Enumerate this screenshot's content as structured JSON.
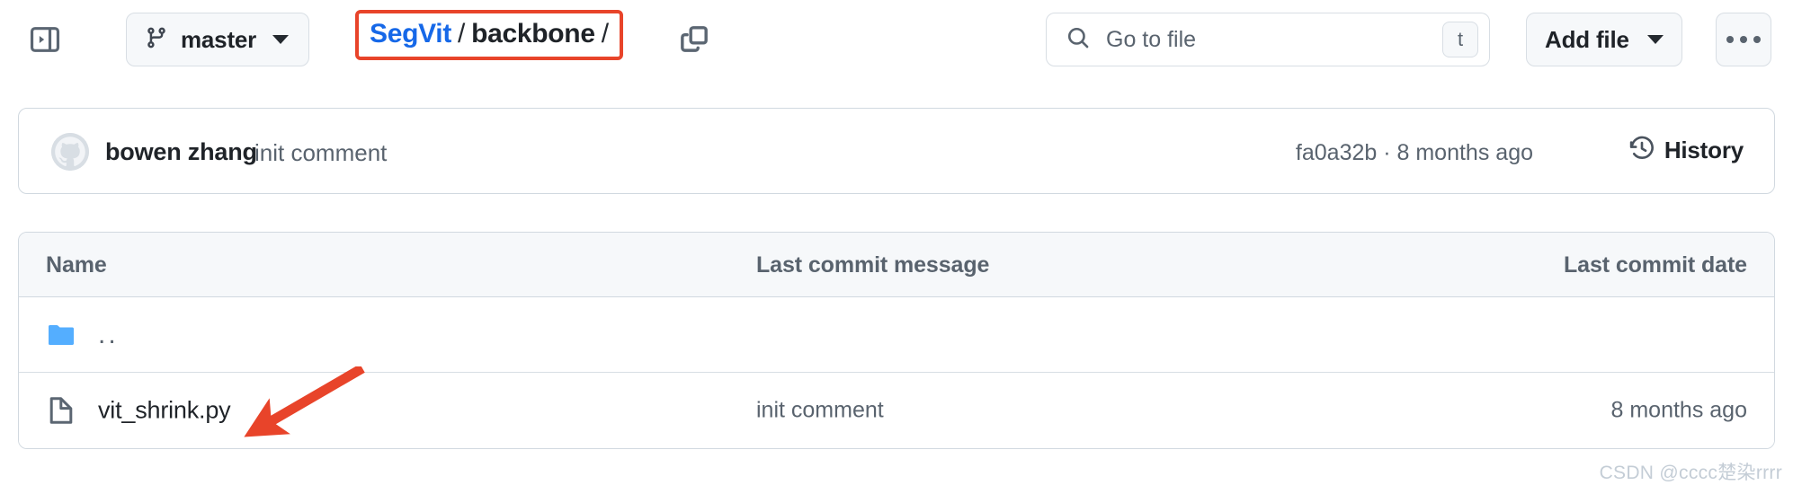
{
  "toolbar": {
    "sidebar_toggle_icon": "sidebar-expand-icon",
    "branch": {
      "icon": "git-branch-icon",
      "name": "master",
      "caret_icon": "chevron-down-icon"
    },
    "breadcrumb": {
      "repo": "SegVit",
      "separator": "/",
      "directory": "backbone",
      "trailing": "/"
    },
    "copy_path_icon": "copy-icon",
    "search": {
      "icon": "search-icon",
      "placeholder": "Go to file",
      "shortcut_key": "t"
    },
    "add_file": {
      "label": "Add file",
      "caret_icon": "chevron-down-icon"
    },
    "more_menu_icon": "kebab-horizontal-icon"
  },
  "commit_bar": {
    "avatar_icon": "octocat-avatar-icon",
    "author": "bowen zhang",
    "message": "init comment",
    "meta": "fa0a32b · 8 months ago",
    "history": {
      "icon": "history-clock-icon",
      "label": "History"
    }
  },
  "file_table": {
    "headers": {
      "name": "Name",
      "message": "Last commit message",
      "date": "Last commit date"
    },
    "rows": [
      {
        "icon": "folder-icon",
        "name": "..",
        "message": "",
        "date": "",
        "type": "parent-directory"
      },
      {
        "icon": "file-icon",
        "name": "vit_shrink.py",
        "message": "init comment",
        "date": "8 months ago",
        "type": "file"
      }
    ]
  },
  "annotations": {
    "highlight_box_color": "#e8442a",
    "arrow_color": "#e8442a",
    "arrow_target": "vit_shrink.py"
  },
  "watermark": "CSDN @cccc楚染rrrr",
  "colors": {
    "link_blue": "#1668e8",
    "text_primary": "#1f2328",
    "text_muted": "#59636e",
    "border": "#d1d9e0",
    "surface": "#f6f8fa",
    "folder_blue": "#54aeff"
  }
}
